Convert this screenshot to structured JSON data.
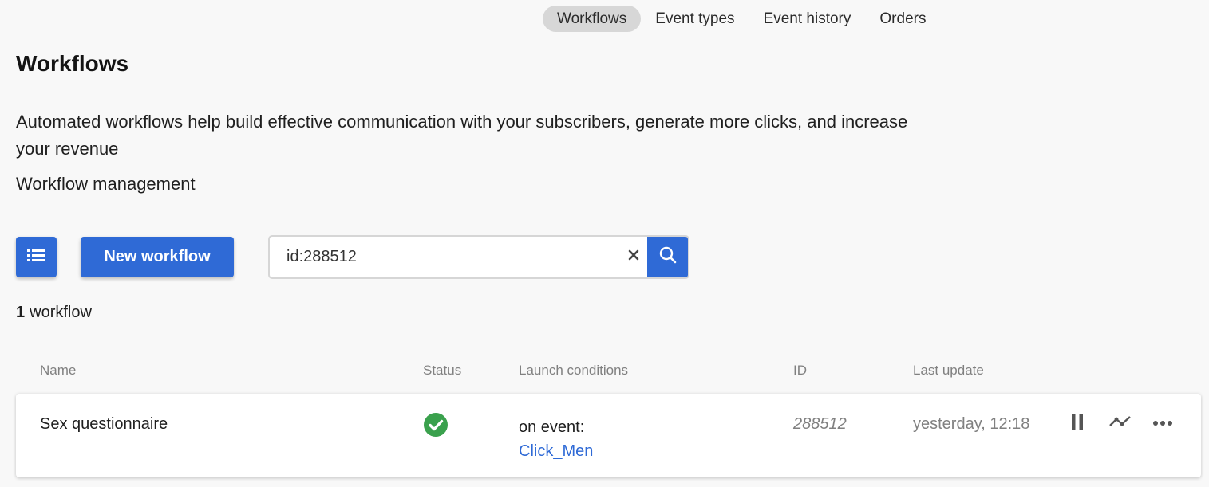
{
  "nav": {
    "tabs": [
      {
        "label": "Workflows",
        "active": true
      },
      {
        "label": "Event types",
        "active": false
      },
      {
        "label": "Event history",
        "active": false
      },
      {
        "label": "Orders",
        "active": false
      }
    ]
  },
  "page": {
    "title": "Workflows",
    "description": "Automated workflows help build effective communication with your subscribers, generate more clicks, and increase your revenue",
    "subtitle": "Workflow management"
  },
  "toolbar": {
    "list_icon": "list-icon",
    "new_label": "New workflow",
    "search_value": "id:288512",
    "clear_icon": "close-icon",
    "search_icon": "search-icon"
  },
  "summary": {
    "count": "1",
    "unit": "workflow"
  },
  "table": {
    "columns": [
      "Name",
      "Status",
      "Launch conditions",
      "ID",
      "Last update"
    ],
    "rows": [
      {
        "name": "Sex questionnaire",
        "status_icon": "check-circle-icon",
        "condition_label": "on event:",
        "condition_event": "Click_Men",
        "id": "288512",
        "last_update": "yesterday, 12:18",
        "actions": [
          "pause-icon",
          "stats-icon",
          "more-icon"
        ]
      }
    ]
  },
  "colors": {
    "accent": "#2f6ad6",
    "success": "#3aa14d",
    "muted": "#808080",
    "nav_active_bg": "#d7d7d7"
  }
}
